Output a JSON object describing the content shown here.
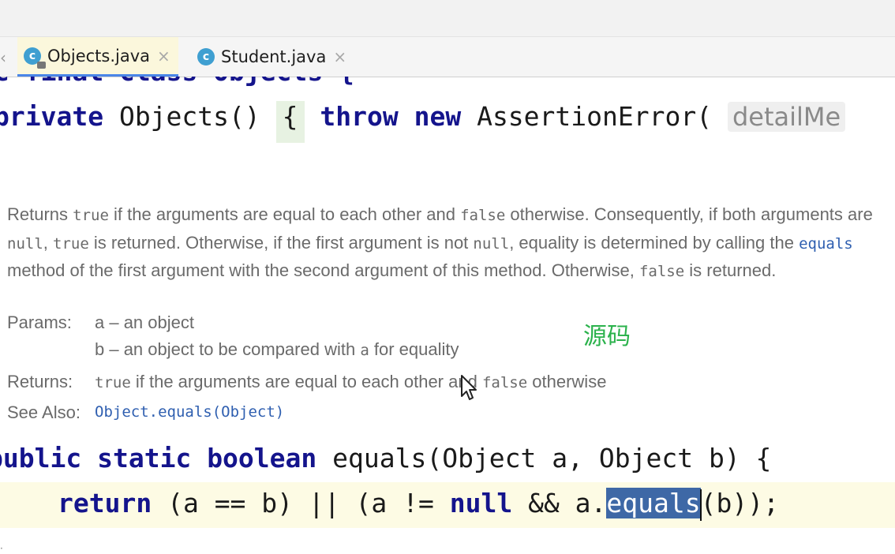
{
  "tabs": [
    {
      "label": "Objects.java",
      "icon": "class-icon",
      "active": true
    },
    {
      "label": "Student.java",
      "icon": "class-icon",
      "active": false
    }
  ],
  "code": {
    "line0": "c final class Objects {",
    "line1_kw": "private",
    "line1_mid": " Objects() ",
    "line1_brace": "{",
    "line1_throw": "throw",
    "line1_new": "new",
    "line1_rest": " AssertionError( ",
    "line1_hint": "detailMe",
    "sig_kw1": "public",
    "sig_kw2": "static",
    "sig_kw3": "boolean",
    "sig_rest": " equals(Object a, Object b) {",
    "ret_kw": "return",
    "ret_mid": " (a == b) || (a != ",
    "ret_null": "null",
    "ret_and": " && a.",
    "ret_sel": "equals",
    "ret_end": "(b));"
  },
  "doc": {
    "d1": "Returns ",
    "d2": "true",
    "d3": " if the arguments are equal to each other and ",
    "d4": "false",
    "d5": " otherwise. Consequently, if both arguments are ",
    "d6": "null",
    "d7": ", ",
    "d8": "true",
    "d9": " is returned. Otherwise, if the first argument is not ",
    "d10": "null",
    "d11": ", equality is determined by calling the ",
    "d12": "equals",
    "d13": " method of the first argument with the second argument of this method. Otherwise, ",
    "d14": "false",
    "d15": " is returned.",
    "params_label": "Params:",
    "param_a": "a – an object",
    "param_b1": "b – an object to be compared with ",
    "param_b2": "a",
    "param_b3": " for equality",
    "returns_label": "Returns:",
    "returns_1": "true",
    "returns_2": " if the arguments are equal to each other and ",
    "returns_3": "false",
    "returns_4": " otherwise",
    "see_label": "See Also:",
    "see_link": "Object.equals(Object)"
  },
  "overlay_text": "源码",
  "colors": {
    "keyword": "#14148c",
    "link": "#2f5fb0",
    "selection": "#3e68a6",
    "overlay": "#2bb24c",
    "tab_active_bg": "#fbf7dc"
  }
}
